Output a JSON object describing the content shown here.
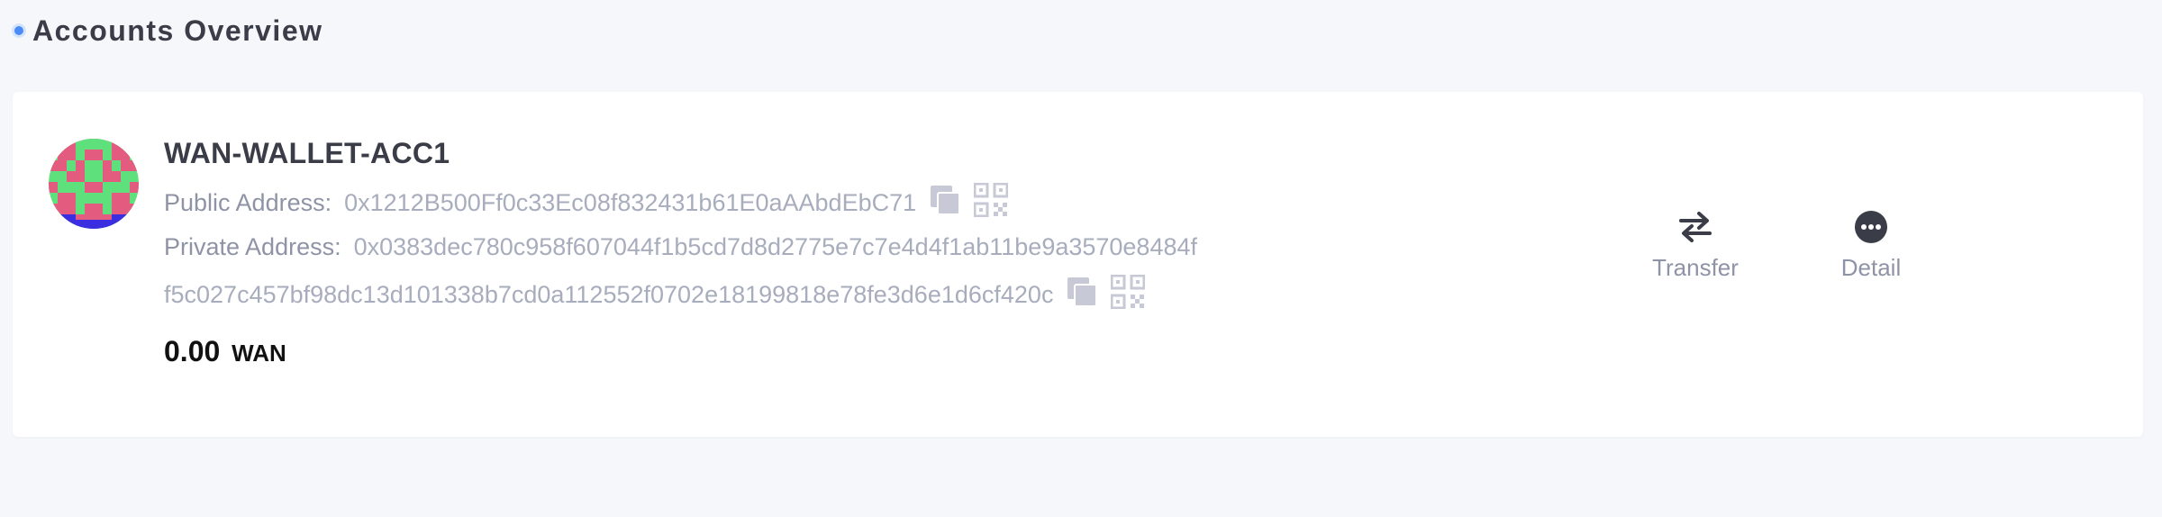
{
  "section": {
    "title": "Accounts Overview"
  },
  "colors": {
    "accent": "#4a8cf7",
    "avatar_green": "#5ee07d",
    "avatar_pink": "#e35b7f",
    "avatar_blue": "#3b2ee0"
  },
  "account": {
    "name": "WAN-WALLET-ACC1",
    "public_label": "Public Address:",
    "public_address": "0x1212B500Ff0c33Ec08f832431b61E0aAAbdEbC71",
    "private_label": "Private Address:",
    "private_address_line1": "0x0383dec780c958f607044f1b5cd7d8d2775e7c7e4d4f1ab11be9a3570e8484f",
    "private_address_line2": "f5c027c457bf98dc13d101338b7cd0a112552f0702e18199818e78fe3d6e1d6cf420c",
    "balance": "0.00",
    "balance_unit": "WAN"
  },
  "actions": {
    "transfer_label": "Transfer",
    "detail_label": "Detail"
  },
  "icons": {
    "copy": "copy-icon",
    "qr": "qrcode-icon",
    "transfer": "swap-arrows-icon",
    "detail": "more-dots-icon"
  }
}
